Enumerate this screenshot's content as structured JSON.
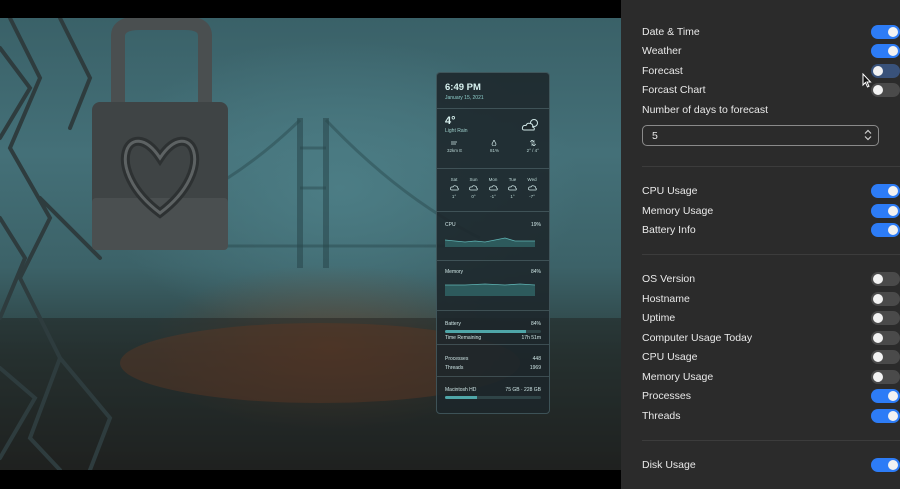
{
  "widget": {
    "time": "6:49 PM",
    "date": "January 15, 2021",
    "temperature": "4°",
    "condition": "Light Rain",
    "wind": "32km E",
    "humidity": "81%",
    "hilo": "2° / 4°",
    "forecast": [
      {
        "day": "Sat",
        "temp": "1°"
      },
      {
        "day": "Sun",
        "temp": "0°"
      },
      {
        "day": "Mon",
        "temp": "-1°"
      },
      {
        "day": "Tue",
        "temp": "1°"
      },
      {
        "day": "Wed",
        "temp": "-7°"
      }
    ],
    "cpu_label": "CPU",
    "cpu_value": "19%",
    "memory_label": "Memory",
    "memory_value": "84%",
    "battery_label": "Battery",
    "battery_value": "84%",
    "battery_fraction": 0.84,
    "time_remaining_label": "Time Remaining",
    "time_remaining_value": "17h 51m",
    "processes_label": "Processes",
    "processes_value": "448",
    "threads_label": "Threads",
    "threads_value": "1969",
    "disk_label": "Macintosh HD",
    "disk_value": "75 GB · 228 GB",
    "disk_fraction": 0.33
  },
  "settings": {
    "date_time": {
      "label": "Date & Time",
      "on": true
    },
    "weather": {
      "label": "Weather",
      "on": true
    },
    "forecast": {
      "label": "Forecast",
      "on": false
    },
    "forcast_chart": {
      "label": "Forcast Chart",
      "on": false
    },
    "days_label": "Number of days to forecast",
    "days_value": "5",
    "cpu_usage": {
      "label": "CPU Usage",
      "on": true
    },
    "memory_usage": {
      "label": "Memory Usage",
      "on": true
    },
    "battery_info": {
      "label": "Battery Info",
      "on": true
    },
    "os_version": {
      "label": "OS Version",
      "on": false
    },
    "hostname": {
      "label": "Hostname",
      "on": false
    },
    "uptime": {
      "label": "Uptime",
      "on": false
    },
    "computer_usage_today": {
      "label": "Computer Usage Today",
      "on": false
    },
    "cpu_usage_2": {
      "label": "CPU Usage",
      "on": false
    },
    "memory_usage_2": {
      "label": "Memory Usage",
      "on": false
    },
    "processes": {
      "label": "Processes",
      "on": true
    },
    "threads": {
      "label": "Threads",
      "on": true
    },
    "disk_usage": {
      "label": "Disk Usage",
      "on": true
    }
  },
  "colors": {
    "toggle_on": "#2d7cf6",
    "toggle_off": "#4a4a4a",
    "panel_bg": "#2b2b2b",
    "widget_accent": "#4fa6a8"
  },
  "icons": {
    "weather": "sun-behind-rain-cloud-icon",
    "wind": "wind-icon",
    "humidity": "droplet-icon",
    "hilo": "up-down-arrows-icon",
    "cursor": "pointer-cursor-icon"
  }
}
